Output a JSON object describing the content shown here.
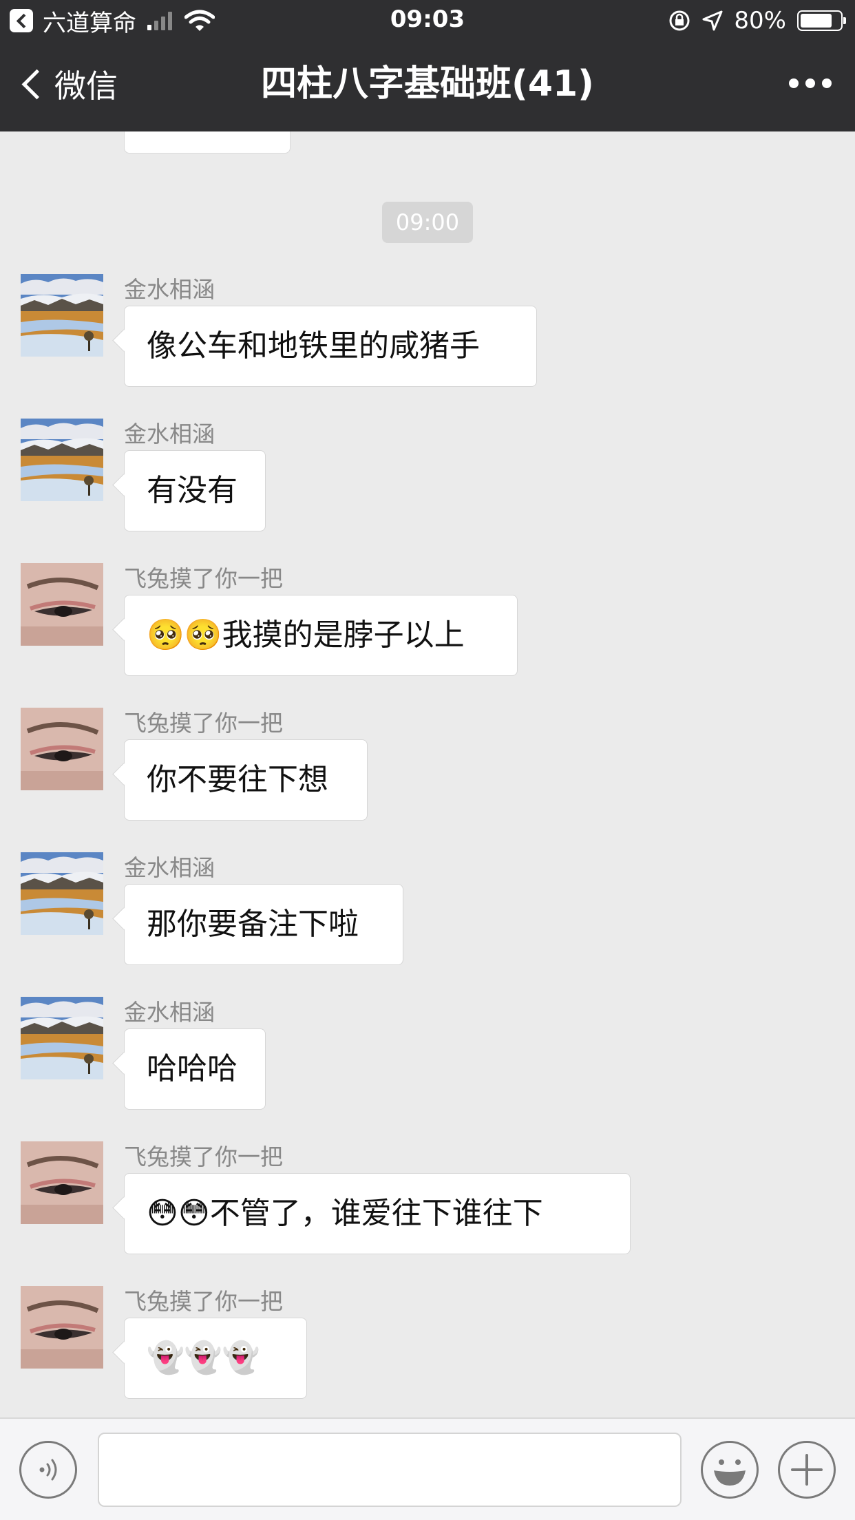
{
  "status_bar": {
    "back_app_label": "六道算命",
    "time": "09:03",
    "battery_percent": "80%",
    "battery_level": 0.8
  },
  "nav": {
    "back_label": "微信",
    "title": "四柱八字基础班(41)"
  },
  "chat": {
    "timestamp": "09:00",
    "messages": [
      {
        "sender": "金水相涵",
        "text": "像公车和地铁里的咸猪手",
        "avatar": "landscape-avatar"
      },
      {
        "sender": "金水相涵",
        "text": "有没有",
        "avatar": "landscape-avatar"
      },
      {
        "sender": "飞兔摸了你一把",
        "text": "🥺🥺我摸的是脖子以上",
        "avatar": "eye-avatar"
      },
      {
        "sender": "飞兔摸了你一把",
        "text": "你不要往下想",
        "avatar": "eye-avatar"
      },
      {
        "sender": "金水相涵",
        "text": "那你要备注下啦",
        "avatar": "landscape-avatar"
      },
      {
        "sender": "金水相涵",
        "text": "哈哈哈",
        "avatar": "landscape-avatar"
      },
      {
        "sender": "飞兔摸了你一把",
        "text": "😳😳不管了，谁爱往下谁往下",
        "avatar": "eye-avatar"
      },
      {
        "sender": "飞兔摸了你一把",
        "text": "👻👻👻",
        "avatar": "eye-avatar"
      }
    ]
  },
  "input_bar": {
    "voice_icon": "voice-icon",
    "emoji_icon": "emoji-icon",
    "plus_icon": "plus-icon"
  },
  "colors": {
    "header_bg": "#2f2f31",
    "chat_bg": "#ebebeb",
    "bubble_bg": "#ffffff",
    "sender_text": "#888888"
  }
}
